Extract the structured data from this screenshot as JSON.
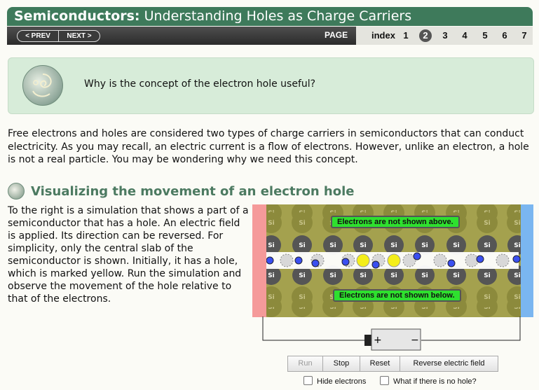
{
  "header": {
    "title_bold": "Semiconductors:",
    "title_rest": "Understanding Holes as Charge Carriers"
  },
  "nav": {
    "prev_label": "< PREV",
    "next_label": "NEXT >",
    "page_label": "PAGE",
    "index_label": "index",
    "pages": [
      "1",
      "2",
      "3",
      "4",
      "5",
      "6",
      "7"
    ],
    "current_page": "2"
  },
  "question": {
    "text": "Why is the concept of the electron hole useful?",
    "icon": "swirl-icon"
  },
  "intro": "Free electrons and holes are considered two types of charge carriers in semiconductors that can conduct electricity. As you may recall, an electric current is a flow of electrons. However, unlike an electron, a hole is not a real particle. You may be wondering why we need this concept.",
  "section": {
    "title": "Visualizing the movement of an electron hole",
    "body": "To the right is a simulation that shows a part of a semiconductor that has a hole. An electric field is applied. Its direction can be reversed. For simplicity, only the central slab of the semiconductor is shown. Initially, it has a hole, which is marked yellow. Run the simulation and observe the movement of the hole relative to that of the electrons."
  },
  "simulation": {
    "atom_label": "Si",
    "note_top": "Electrons are not shown above.",
    "note_bottom": "Electrons are not shown below.",
    "battery_plus": "+",
    "battery_minus": "−",
    "colors": {
      "left_plate": "#f59a9a",
      "right_plate": "#7ab6f0",
      "lattice": "#a4a14e",
      "hole": "#f4ee1a",
      "electron": "#3a4ff0"
    }
  },
  "controls": {
    "run": "Run",
    "stop": "Stop",
    "reset": "Reset",
    "reverse": "Reverse electric field",
    "hide_electrons": "Hide electrons",
    "no_hole": "What if there is no hole?"
  }
}
